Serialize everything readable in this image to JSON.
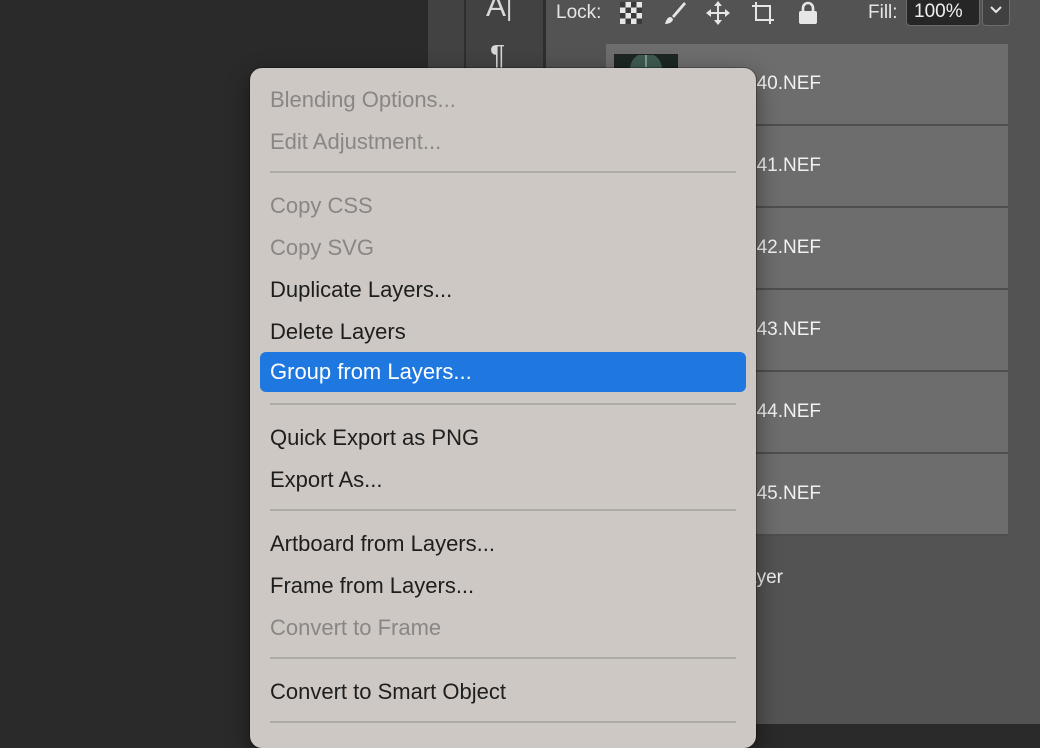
{
  "toolbar": {
    "lock_label": "Lock:",
    "fill_label": "Fill:",
    "fill_value": "100%"
  },
  "layers": [
    {
      "name": "540.NEF"
    },
    {
      "name": "541.NEF"
    },
    {
      "name": "542.NEF"
    },
    {
      "name": "543.NEF"
    },
    {
      "name": "544.NEF"
    },
    {
      "name": "545.NEF"
    },
    {
      "name": "ayer"
    }
  ],
  "menu": {
    "items": [
      {
        "label": "Blending Options...",
        "enabled": false
      },
      {
        "label": "Edit Adjustment...",
        "enabled": false
      },
      {
        "label": "Copy CSS",
        "enabled": false
      },
      {
        "label": "Copy SVG",
        "enabled": false
      },
      {
        "label": "Duplicate Layers...",
        "enabled": true
      },
      {
        "label": "Delete Layers",
        "enabled": true
      },
      {
        "label": "Group from Layers...",
        "enabled": true,
        "selected": true
      },
      {
        "label": "Quick Export as PNG",
        "enabled": true
      },
      {
        "label": "Export As...",
        "enabled": true
      },
      {
        "label": "Artboard from Layers...",
        "enabled": true
      },
      {
        "label": "Frame from Layers...",
        "enabled": true
      },
      {
        "label": "Convert to Frame",
        "enabled": false
      },
      {
        "label": "Convert to Smart Object",
        "enabled": true
      }
    ]
  },
  "colors": {
    "selection": "#1f78e0",
    "menu_bg": "#cdc8c4",
    "panel_bg": "#535353"
  }
}
